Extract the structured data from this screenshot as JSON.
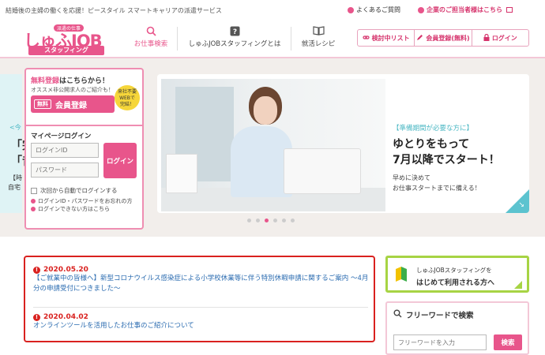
{
  "topbar": {
    "tagline": "結婚後の主婦の働くを応援！ピースタイル スマートキャリアの派遣サービス",
    "faq": "よくあるご質問",
    "corp": "企業のご担当者様はこちら"
  },
  "logo": {
    "badge": "派遣の仕事",
    "main": "しゅふJOB",
    "sub": "スタッフィング"
  },
  "nav": [
    {
      "label": "お仕事検索",
      "icon": "search-icon"
    },
    {
      "label": "しゅふJOBスタッフィングとは",
      "icon": "question-icon"
    },
    {
      "label": "就活レシピ",
      "icon": "book-icon"
    }
  ],
  "header_buttons": [
    {
      "label": "検討中リスト",
      "icon": "link-icon"
    },
    {
      "label": "会員登録(無料)",
      "icon": "pencil-icon"
    },
    {
      "label": "ログイン",
      "icon": "lock-icon"
    }
  ],
  "slide_prev": {
    "t1": "<今",
    "t2": "「完",
    "t3": "「昔",
    "t4": "【時",
    "t5": "自宅"
  },
  "slide": {
    "category": "【準備期間が必要な方に】",
    "head1": "ゆとりをもって",
    "head2": "7月以降でスタート！",
    "sub1": "早めに決めて",
    "sub2": "お仕事スタートまでに備える！"
  },
  "carousel": {
    "count": 6,
    "active": 3
  },
  "login_panel": {
    "reg_title_pink": "無料登録",
    "reg_title_rest": "はこちらから！",
    "reg_desc": "オススメ非公開求人のご紹介も！",
    "reg_free": "無料",
    "reg_button": "会員登録",
    "webok": [
      "来社不要",
      "WEBで",
      "完結！"
    ],
    "mypage_title": "マイページログイン",
    "id_placeholder": "ログインID",
    "pw_placeholder": "パスワード",
    "login_button": "ログイン",
    "auto_login": "次回から自動でログインする",
    "forgot": "ログインID・パスワードをお忘れの方",
    "cannot": "ログインできない方はこちら"
  },
  "news": [
    {
      "date": "2020.05.20",
      "text": "【ご就業中の皆様へ】新型コロナウイルス感染症による小学校休業等に伴う特別休暇申請に関するご案内 ～4月分の申請受付につきました～"
    },
    {
      "date": "2020.04.02",
      "text": "オンラインツールを活用したお仕事のご紹介について"
    }
  ],
  "beginner": {
    "line1": "しゅふJOBスタッフィングを",
    "line2": "はじめて利用される方へ"
  },
  "freeword": {
    "title": "フリーワードで検索",
    "placeholder": "フリーワードを入力",
    "button": "検索"
  },
  "colors": {
    "brand_pink": "#e8558b",
    "news_red": "#d9211f",
    "accent_teal": "#4cb8c4",
    "beginner_green": "#a7d444"
  }
}
